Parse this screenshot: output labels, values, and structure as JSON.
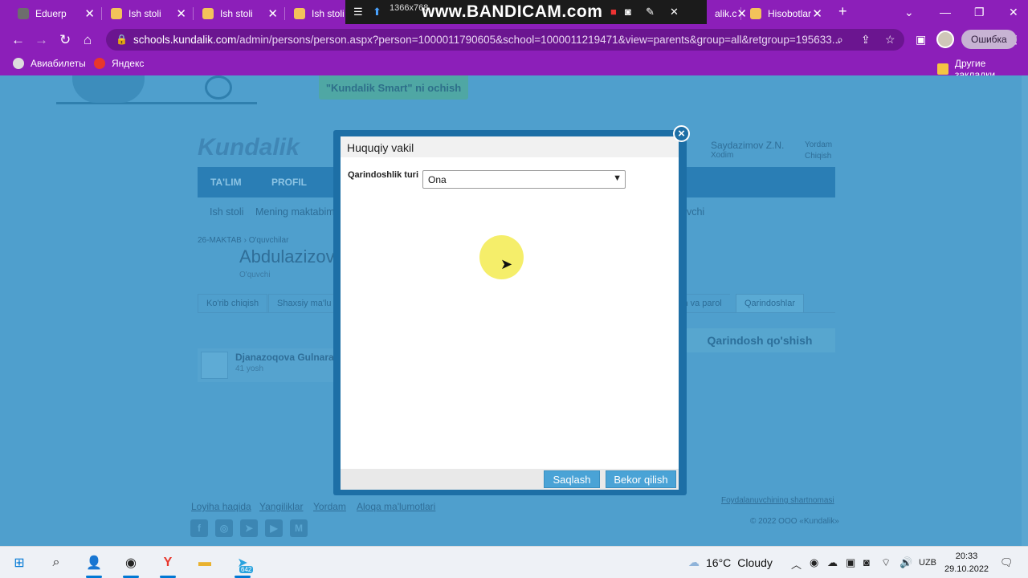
{
  "browser": {
    "tabs": [
      {
        "label": "Eduerp",
        "color": "#6d6d6d"
      },
      {
        "label": "Ish stoli",
        "color": "#f3c35a"
      },
      {
        "label": "Ish stoli",
        "color": "#f3c35a"
      },
      {
        "label": "Ish stoli",
        "color": "#f3c35a"
      },
      {
        "label": "alik.c",
        "color": "#f3c35a"
      },
      {
        "label": "Hisobotlar",
        "color": "#f3c35a"
      }
    ],
    "recorder": {
      "resolution": "1366x768",
      "brand": "www.BANDICAM.com"
    },
    "url_host": "schools.kundalik.com",
    "url_rest": "/admin/persons/person.aspx?person=1000011790605&school=1000011219471&view=parents&group=all&retgroup=195633...",
    "error_button": "Ошибка",
    "bookmarks": [
      "Авиабилеты",
      "Яндекс"
    ],
    "other_bookmarks": "Другие закладки"
  },
  "page": {
    "smart_button": "\"Kundalik Smart\" ni ochish",
    "logo": "Kundalik",
    "user_name": "Saydazimov Z.N.",
    "user_role": "Xodim",
    "help": "Yordam",
    "logout": "Chiqish",
    "nav": [
      "TA'LIM",
      "PROFIL"
    ],
    "subnav": [
      "Ish stoli",
      "Mening maktabim",
      "uvchi"
    ],
    "breadcrumb": [
      "26-MAKTAB",
      "O'quvchilar"
    ],
    "person_name": "Abdulazizov",
    "person_role": "O'quvchi",
    "tabs": [
      "Ko'rib chiqish",
      "Shaxsiy ma'lu",
      "in va parol",
      "Qarindoshlar"
    ],
    "add_relative": "Qarindosh qo'shish",
    "relative": {
      "name": "Djanazoqova Gulnara",
      "age": "41 yosh"
    },
    "footer_links": [
      "Loyiha haqida",
      "Yangiliklar",
      "Yordam",
      "Aloqa ma'lumotlari"
    ],
    "terms": "Foydalanuvchining shartnomasi",
    "copyright": "© 2022 ООО «Kundalik»",
    "social": [
      "f",
      "◎",
      "➤",
      "▶",
      "M"
    ]
  },
  "modal": {
    "title": "Huquqiy vakil",
    "field_label": "Qarindoshlik turi",
    "select_value": "Ona",
    "save": "Saqlash",
    "cancel": "Bekor qilish"
  },
  "taskbar": {
    "weather_temp": "16°C",
    "weather_text": "Cloudy",
    "lang": "UZB",
    "time": "20:33",
    "date": "29.10.2022",
    "telegram_badge": "642"
  },
  "colors": {
    "browser": "#8c1fb9",
    "modal_frame": "#1d6fa6",
    "button": "#4aa3d6"
  }
}
